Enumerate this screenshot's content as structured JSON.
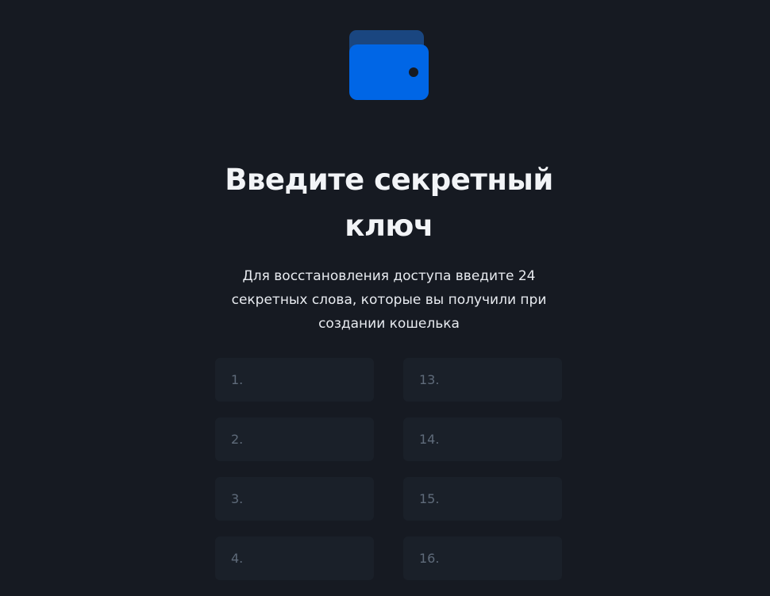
{
  "logo": {
    "icon": "wallet-icon",
    "colors": {
      "front": "#0066e6",
      "back": "#1a4680",
      "clasp": "#161a22"
    }
  },
  "header": {
    "title": "Введите секретный ключ",
    "subtitle": "Для восстановления доступа введите 24 секретных слова, которые вы получили при создании кошелька"
  },
  "fields": {
    "f1": {
      "placeholder": "1."
    },
    "f13": {
      "placeholder": "13."
    },
    "f2": {
      "placeholder": "2."
    },
    "f14": {
      "placeholder": "14."
    },
    "f3": {
      "placeholder": "3."
    },
    "f15": {
      "placeholder": "15."
    },
    "f4": {
      "placeholder": "4."
    },
    "f16": {
      "placeholder": "16."
    }
  },
  "colors": {
    "background": "#161a22",
    "field_background": "#1a2029",
    "placeholder": "#5f6b7a"
  }
}
